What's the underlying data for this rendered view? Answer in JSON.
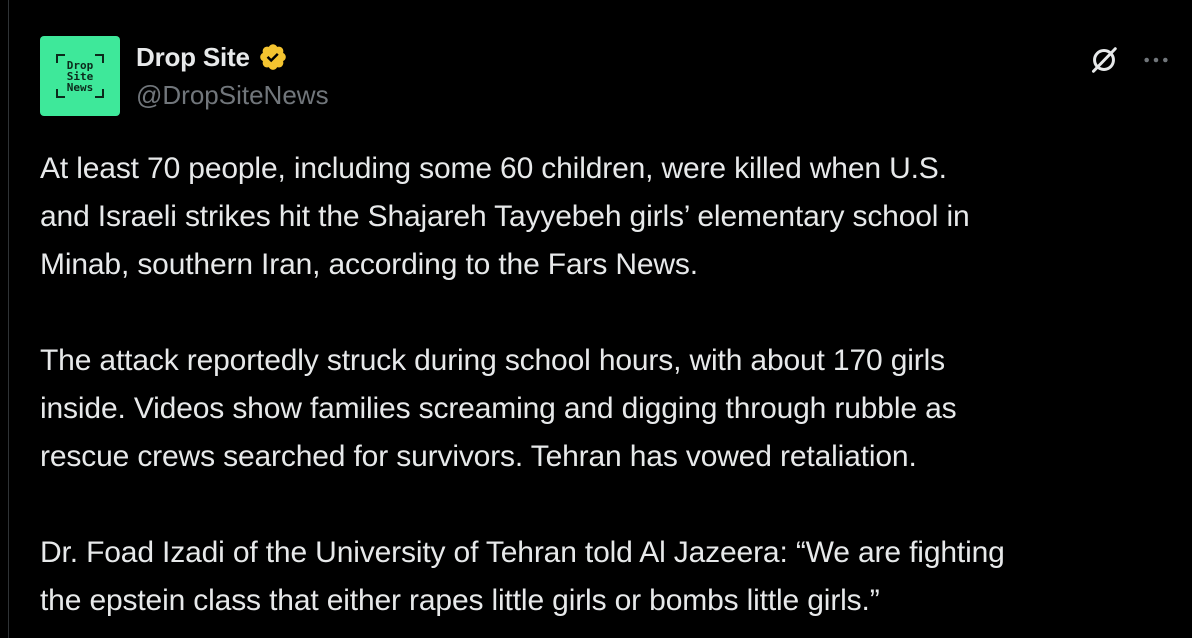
{
  "tweet": {
    "avatar": {
      "lines": [
        "Drop",
        "Site",
        "News"
      ],
      "color": "#3ee89a"
    },
    "display_name": "Drop Site",
    "handle": "@DropSiteNews",
    "verified_badge_color": "#f4c430",
    "icons": {
      "grok": "grok-icon",
      "more": "more-icon"
    },
    "paragraphs": [
      "At least 70 people, including some 60 children, were killed when U.S.\nand Israeli strikes hit the Shajareh Tayyebeh girls’ elementary school in\nMinab, southern Iran, according to the Fars News.",
      "The attack reportedly struck during school hours, with about 170 girls\ninside. Videos show families screaming and digging through rubble as\nrescue crews searched for survivors. Tehran has vowed retaliation.",
      "Dr. Foad Izadi of the University of Tehran told Al Jazeera: “We are fighting\nthe epstein class that either rapes little girls or bombs little girls.”"
    ]
  }
}
